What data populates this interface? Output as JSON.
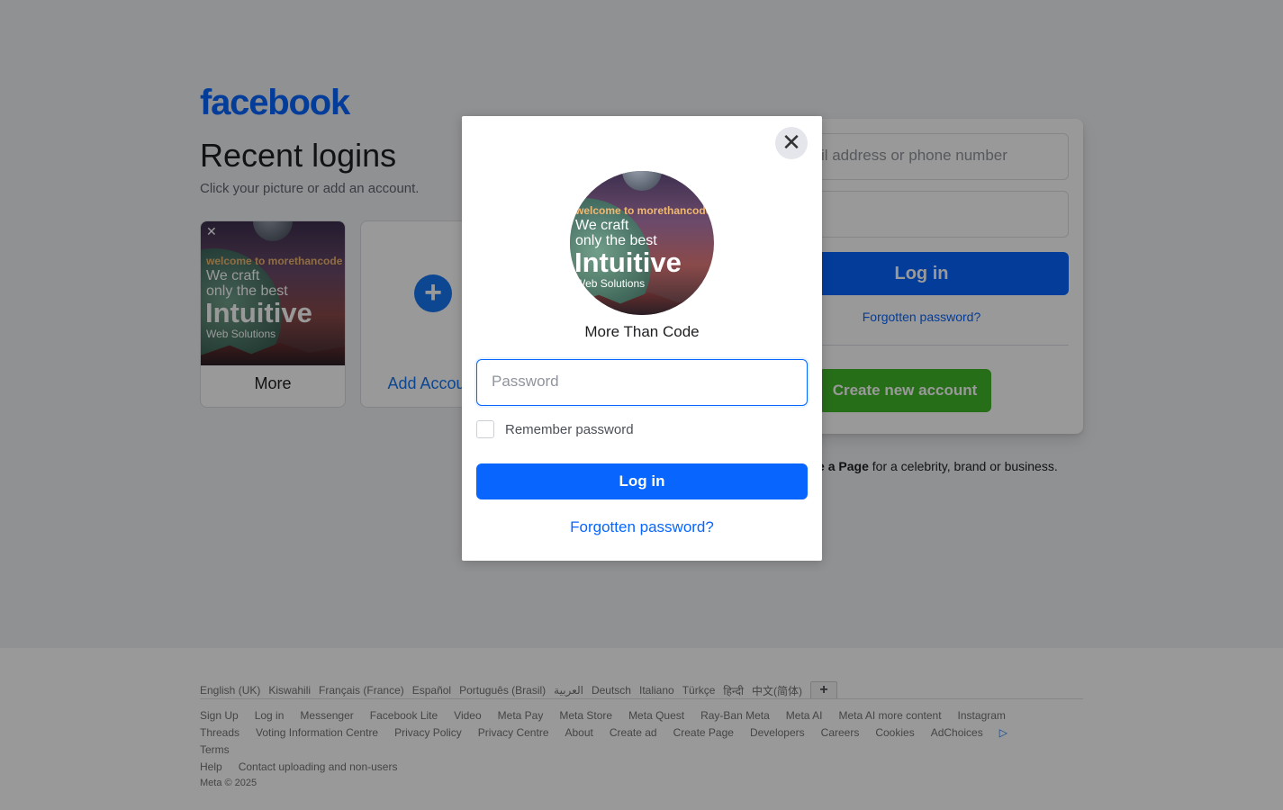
{
  "brand": {
    "logo": "facebook",
    "accent": "#0866ff"
  },
  "recent": {
    "title": "Recent logins",
    "subtitle": "Click your picture or add an account.",
    "accounts": [
      {
        "name": "More",
        "remove_icon": "close-icon"
      },
      {
        "name": "Add Account",
        "icon": "plus-icon"
      }
    ]
  },
  "avatar_art": {
    "line1": "welcome to morethancode",
    "line2": "We craft",
    "line3": "only the best",
    "line4": "Intuitive",
    "line5": "Web Solutions"
  },
  "login_box": {
    "email_placeholder": "Email address or phone number",
    "password_placeholder": "Password",
    "login_label": "Log in",
    "forgot_label": "Forgotten password?",
    "create_label": "Create new account",
    "create_page_bold": "Create a Page",
    "create_page_rest": " for a celebrity, brand or business."
  },
  "modal": {
    "account_name": "More Than Code",
    "password_placeholder": "Password",
    "remember_label": "Remember password",
    "login_label": "Log in",
    "forgot_label": "Forgotten password?",
    "close_icon": "close-icon"
  },
  "footer": {
    "languages": [
      "English (UK)",
      "Kiswahili",
      "Français (France)",
      "Español",
      "Português (Brasil)",
      "العربية",
      "Deutsch",
      "Italiano",
      "Türkçe",
      "हिन्दी",
      "中文(简体)"
    ],
    "more_languages": "+",
    "links": [
      "Sign Up",
      "Log in",
      "Messenger",
      "Facebook Lite",
      "Video",
      "Meta Pay",
      "Meta Store",
      "Meta Quest",
      "Ray-Ban Meta",
      "Meta AI",
      "Meta AI more content",
      "Instagram",
      "Threads",
      "Voting Information Centre",
      "Privacy Policy",
      "Privacy Centre",
      "About",
      "Create ad",
      "Create Page",
      "Developers",
      "Careers",
      "Cookies",
      "AdChoices",
      "Terms",
      "Help",
      "Contact uploading and non-users"
    ],
    "copyright": "Meta © 2025"
  }
}
